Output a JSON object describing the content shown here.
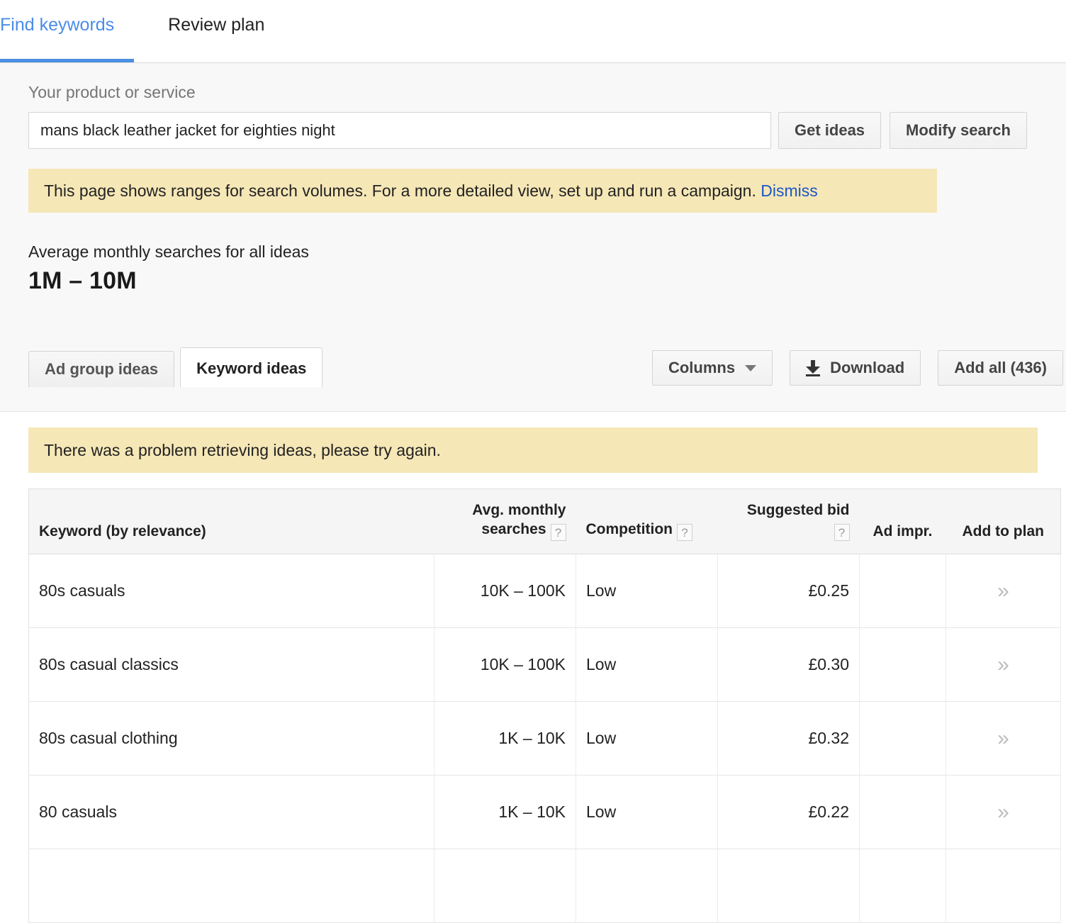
{
  "top_tabs": [
    {
      "label": "Find keywords",
      "active": true
    },
    {
      "label": "Review plan",
      "active": false
    }
  ],
  "query": {
    "field_label": "Your product or service",
    "input_value": "mans black leather jacket for eighties night",
    "input_placeholder": "Your product or service",
    "get_ideas_label": "Get ideas",
    "modify_search_label": "Modify search"
  },
  "notice": {
    "text": "This page shows ranges for search volumes. For a more detailed view, set up and run a campaign.",
    "dismiss_label": "Dismiss",
    "background": "#f6e7b7",
    "link_color": "#1a57c8"
  },
  "stat": {
    "label": "Average monthly searches for all ideas",
    "value": "1M – 10M"
  },
  "sub_tabs": [
    {
      "label": "Ad group ideas",
      "active": false
    },
    {
      "label": "Keyword ideas",
      "active": true
    }
  ],
  "toolbar": {
    "columns_label": "Columns",
    "download_label": "Download",
    "add_all_label": "Add all (436)"
  },
  "error_banner": {
    "text": "There was a problem retrieving ideas, please try again."
  },
  "table": {
    "headers": {
      "keyword": "Keyword (by relevance)",
      "avg_monthly_searches": "Avg. monthly searches",
      "competition": "Competition",
      "suggested_bid": "Suggested bid",
      "ad_impr": "Ad impr.",
      "add_to_plan": "Add to plan",
      "help_glyph": "?"
    },
    "add_chevron": "»",
    "rows": [
      {
        "keyword": "80s casuals",
        "avg_monthly_searches": "10K – 100K",
        "competition": "Low",
        "suggested_bid": "£0.25",
        "ad_impr": ""
      },
      {
        "keyword": "80s casual classics",
        "avg_monthly_searches": "10K – 100K",
        "competition": "Low",
        "suggested_bid": "£0.30",
        "ad_impr": ""
      },
      {
        "keyword": "80s casual clothing",
        "avg_monthly_searches": "1K – 10K",
        "competition": "Low",
        "suggested_bid": "£0.32",
        "ad_impr": ""
      },
      {
        "keyword": "80 casuals",
        "avg_monthly_searches": "1K – 10K",
        "competition": "Low",
        "suggested_bid": "£0.22",
        "ad_impr": ""
      }
    ]
  },
  "colors": {
    "accent": "#4a90e2",
    "banner": "#f6e7b7",
    "panel_bg": "#f8f8f8",
    "header_bg": "#f5f5f5"
  }
}
